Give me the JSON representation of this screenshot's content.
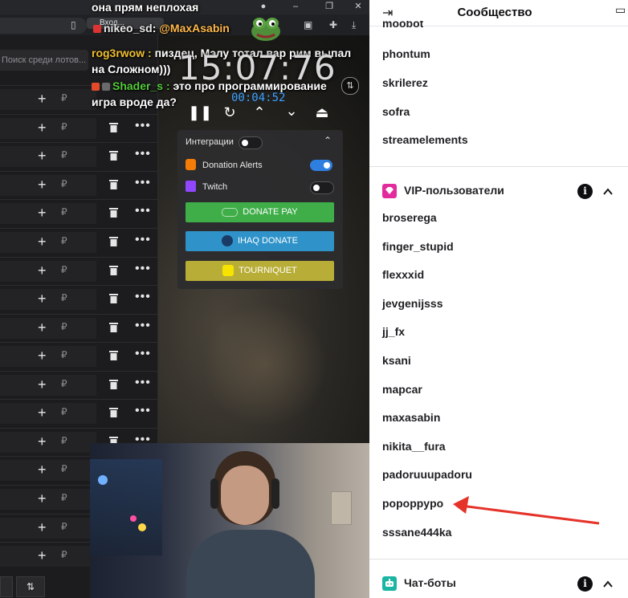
{
  "stream": {
    "browser": {
      "tab_title": "Вход...",
      "search_placeholder": "Поиск среди лотов...",
      "rub_sign": "₽"
    },
    "chat": [
      {
        "nick": "",
        "text": "она прям неплохая"
      },
      {
        "nick": "nikeo_sd",
        "sep": ":",
        "text": "@MaxAsabin"
      },
      {
        "nick": "rog3rwow",
        "sep": ":",
        "text": "пиздец, Мэлу тотал вар рим выпал"
      },
      {
        "nick": "",
        "text": "на Сложном)))"
      },
      {
        "nick": "Shader_s",
        "sep": ":",
        "text": "это про программирование"
      },
      {
        "nick": "",
        "text": "игра вроде да?"
      }
    ],
    "timer": {
      "clock": "15:07:76",
      "elapsed": "00:04:52"
    },
    "integrations": {
      "title": "Интеграции",
      "items": [
        {
          "label": "Donation Alerts",
          "on": true
        },
        {
          "label": "Twitch",
          "on": false
        }
      ],
      "buttons": [
        {
          "label": "DONATE PAY",
          "color": "#3fae49"
        },
        {
          "label": "IHAQ DONATE",
          "color": "#2f93c9"
        },
        {
          "label": "TOURNIQUET",
          "color": "#b8ad36"
        }
      ]
    },
    "colors": {
      "nick_nikeo": "#e8e8e8",
      "nick_rog3rwow": "#f0c030",
      "nick_shader": "#54c83a",
      "mention": "#ffb84a",
      "accent_blue": "#3aa0ff"
    }
  },
  "panel": {
    "title": "Сообщество",
    "top_users": [
      "moobot",
      "phontum",
      "skrilerez",
      "sofra",
      "streamelements"
    ],
    "vip_section": {
      "title": "VIP-пользователи",
      "icon": "diamond-icon",
      "users": [
        "broserega",
        "finger_stupid",
        "flexxxid",
        "jevgenijsss",
        "jj_fx",
        "ksani",
        "mapcar",
        "maxasabin",
        "nikita__fura",
        "padoruuupadoru",
        "popoppypo",
        "sssane444ka"
      ]
    },
    "bots_section": {
      "title": "Чат-боты",
      "icon": "robot-icon"
    },
    "colors": {
      "vip": "#e22b9c",
      "bots": "#1bb5a4",
      "arrow": "#e5332a"
    }
  }
}
